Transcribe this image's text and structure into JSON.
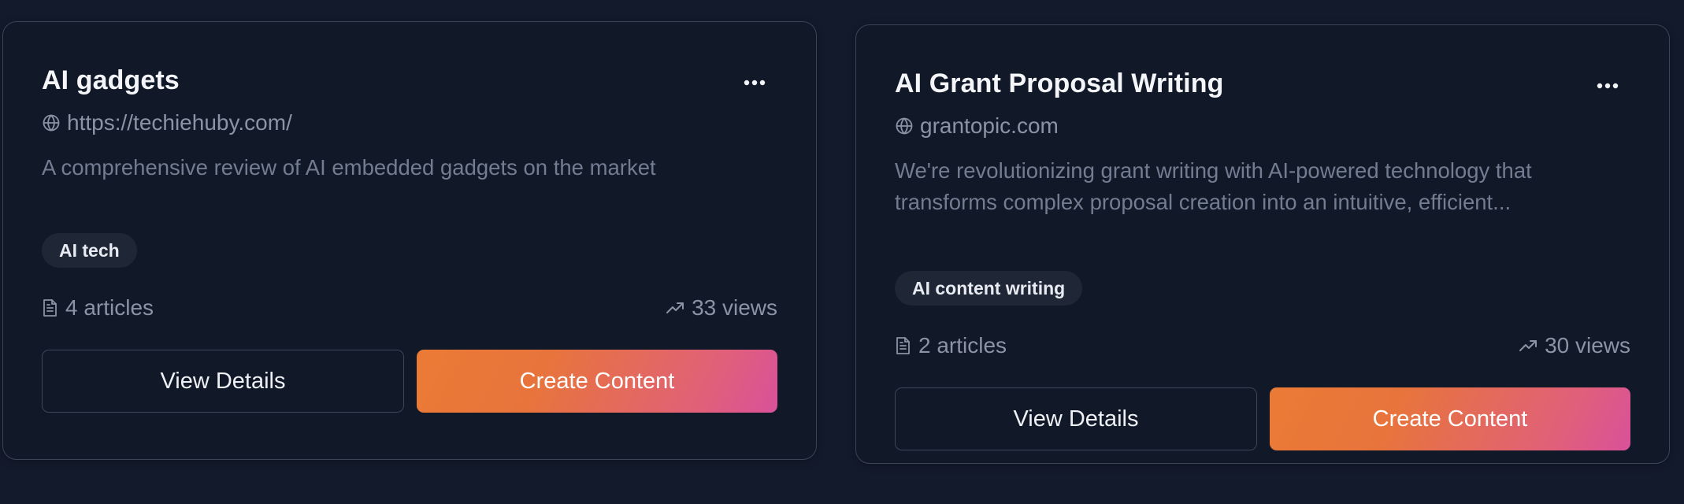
{
  "cards": [
    {
      "title": "AI gadgets",
      "url": "https://techiehuby.com/",
      "description": "A comprehensive review of AI embedded gadgets on the market",
      "tag": "AI tech",
      "articles": "4 articles",
      "views": "33 views",
      "view_details_label": "View Details",
      "create_content_label": "Create Content"
    },
    {
      "title": "AI Grant Proposal Writing",
      "url": "grantopic.com",
      "description": "We're revolutionizing grant writing with AI-powered technology that transforms complex proposal creation into an intuitive, efficient...",
      "tag": "AI content writing",
      "articles": "2 articles",
      "views": "30 views",
      "view_details_label": "View Details",
      "create_content_label": "Create Content"
    }
  ],
  "icons": {
    "more": "more-horizontal-icon",
    "website": "globe-icon",
    "articles": "document-icon",
    "views": "trending-up-icon"
  },
  "colors": {
    "background": "#131a2b",
    "card": "#111828",
    "border": "#3a4558",
    "accent_start": "#ea7b35",
    "accent_end": "#d9519a"
  }
}
